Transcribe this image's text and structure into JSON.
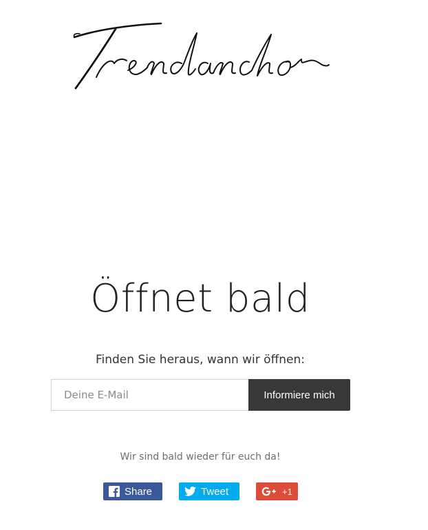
{
  "brand": {
    "logo_text": "Trendanchor"
  },
  "main": {
    "headline": "Öffnet bald",
    "subtitle": "Finden Sie heraus, wann wir öffnen:",
    "email_placeholder": "Deine E-Mail",
    "email_value": "",
    "submit_label": "Informiere mich",
    "footer_note": "Wir sind bald wieder für euch da!"
  },
  "share": {
    "facebook": {
      "label": "Share",
      "icon": "facebook-icon",
      "color": "#3b5998"
    },
    "twitter": {
      "label": "Tweet",
      "icon": "twitter-icon",
      "color": "#00aced"
    },
    "googleplus": {
      "label": "+1",
      "icon": "google-plus-icon",
      "color": "#dd4b39"
    }
  }
}
